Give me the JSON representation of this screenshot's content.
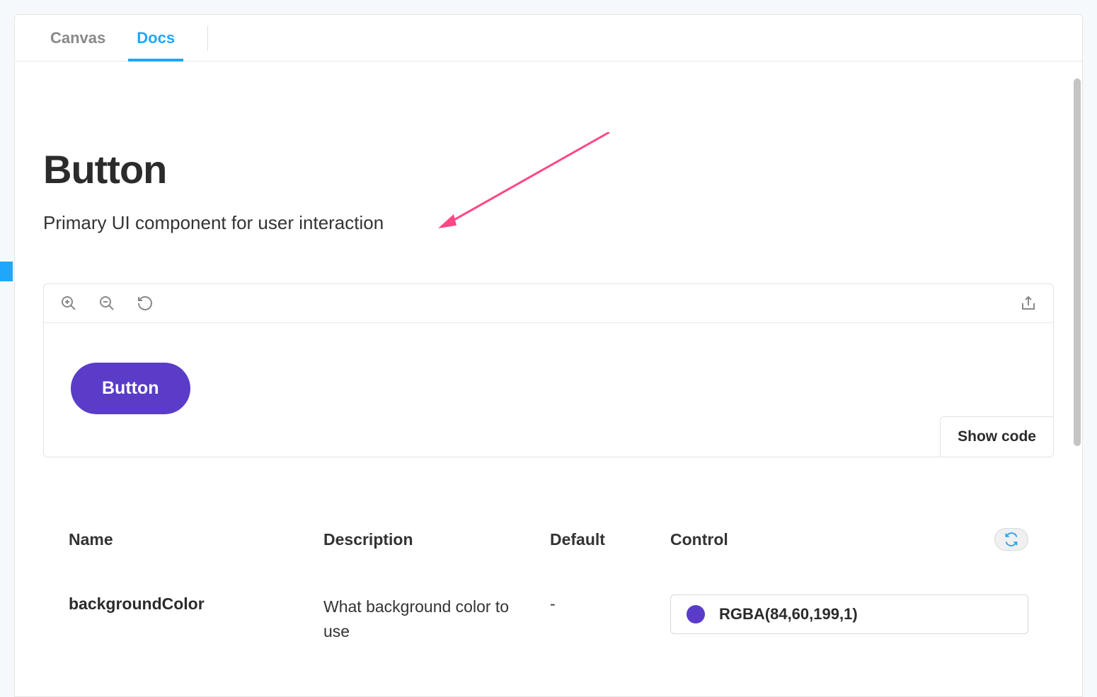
{
  "tabs": [
    {
      "label": "Canvas",
      "active": false
    },
    {
      "label": "Docs",
      "active": true
    }
  ],
  "page": {
    "title": "Button",
    "subtitle": "Primary UI component for user interaction"
  },
  "preview": {
    "button_label": "Button",
    "button_bg": "#5a3cc8",
    "show_code_label": "Show code"
  },
  "args": {
    "headers": {
      "name": "Name",
      "description": "Description",
      "default": "Default",
      "control": "Control"
    },
    "rows": [
      {
        "name": "backgroundColor",
        "description": "What background color to use",
        "default": "-",
        "control_value": "RGBA(84,60,199,1)",
        "control_swatch": "#5a3cc8"
      }
    ]
  }
}
